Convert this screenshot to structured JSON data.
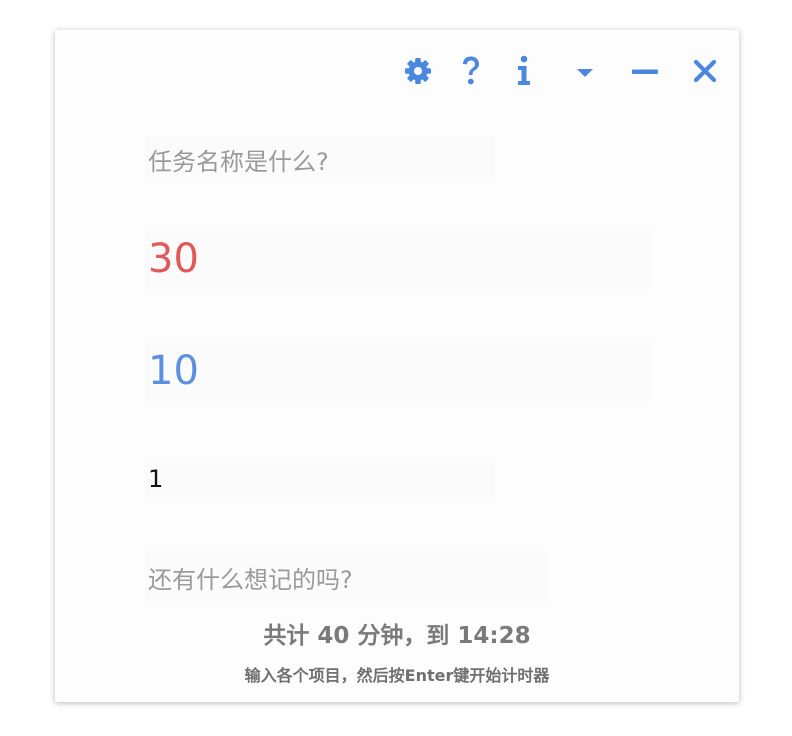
{
  "colors": {
    "accent": "#4a88e0",
    "work": "#e05a5a",
    "break": "#5b8fe0",
    "muted": "#9a9a9a"
  },
  "titlebar": {
    "icons": [
      "gear-icon",
      "question-icon",
      "info-icon",
      "caret-down-icon",
      "minimize-icon",
      "close-icon"
    ]
  },
  "form": {
    "task_placeholder": "任务名称是什么?",
    "work_minutes": "30",
    "break_minutes": "10",
    "rounds": "1",
    "notes_placeholder": "还有什么想记的吗?"
  },
  "footer": {
    "summary": "共计 40 分钟，到 14:28",
    "hint": "输入各个项目，然后按Enter键开始计时器"
  }
}
